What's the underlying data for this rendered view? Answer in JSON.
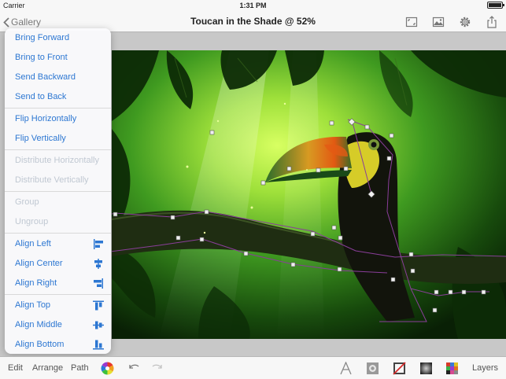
{
  "status_bar": {
    "carrier": "Carrier",
    "time": "1:31 PM",
    "battery_level": 1.0
  },
  "nav": {
    "back_label": "Gallery",
    "title": "Toucan in the Shade @ 52%",
    "icons": [
      "fullscreen-icon",
      "image-icon",
      "settings-gear-icon",
      "share-icon"
    ]
  },
  "arrange_menu": {
    "groups": [
      [
        {
          "label": "Bring Forward",
          "enabled": true
        },
        {
          "label": "Bring to Front",
          "enabled": true
        },
        {
          "label": "Send Backward",
          "enabled": true
        },
        {
          "label": "Send to Back",
          "enabled": true
        }
      ],
      [
        {
          "label": "Flip Horizontally",
          "enabled": true
        },
        {
          "label": "Flip Vertically",
          "enabled": true
        }
      ],
      [
        {
          "label": "Distribute Horizontally",
          "enabled": false
        },
        {
          "label": "Distribute Vertically",
          "enabled": false
        }
      ],
      [
        {
          "label": "Group",
          "enabled": false
        },
        {
          "label": "Ungroup",
          "enabled": false
        }
      ],
      [
        {
          "label": "Align Left",
          "enabled": true,
          "icon": "align-left-icon"
        },
        {
          "label": "Align Center",
          "enabled": true,
          "icon": "align-center-icon"
        },
        {
          "label": "Align Right",
          "enabled": true,
          "icon": "align-right-icon"
        }
      ],
      [
        {
          "label": "Align Top",
          "enabled": true,
          "icon": "align-top-icon"
        },
        {
          "label": "Align Middle",
          "enabled": true,
          "icon": "align-middle-icon"
        },
        {
          "label": "Align Bottom",
          "enabled": true,
          "icon": "align-bottom-icon"
        }
      ]
    ]
  },
  "toolbar": {
    "edit_label": "Edit",
    "arrange_label": "Arrange",
    "path_label": "Path",
    "layers_label": "Layers",
    "icons": [
      "color-wheel-icon",
      "undo-icon",
      "redo-icon",
      "text-tool-icon",
      "shape-tool-icon",
      "mask-icon",
      "gradient-icon",
      "swatches-icon"
    ]
  },
  "colors": {
    "accent": "#2d77d2",
    "disabled": "#c0c8d2",
    "selection_path": "#8a3e9a",
    "foliage_bright": "#b8f040",
    "foliage_dark": "#0c2a06"
  }
}
